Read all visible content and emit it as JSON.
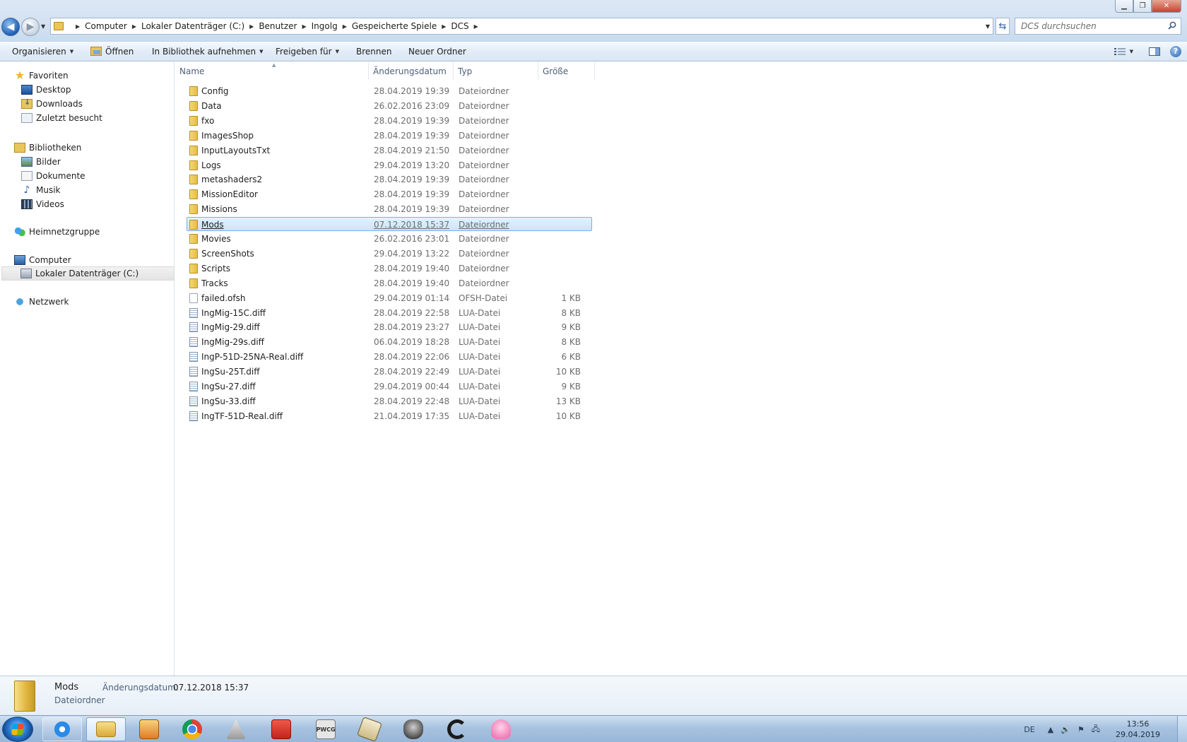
{
  "window": {
    "minimize_glyph": "▁",
    "maximize_glyph": "❐",
    "close_glyph": "✕"
  },
  "nav_buttons": {
    "back_glyph": "◀",
    "forward_glyph": "▶",
    "history_glyph": "▼"
  },
  "address_bar": {
    "breadcrumbs": [
      "Computer",
      "Lokaler Datenträger (C:)",
      "Benutzer",
      "Ingolg",
      "Gespeicherte Spiele",
      "DCS"
    ],
    "separator_glyph": "▶",
    "dropdown_glyph": "▼",
    "refresh_glyph": "⇆"
  },
  "search": {
    "placeholder": "DCS durchsuchen",
    "icon": "search-icon"
  },
  "command_bar": {
    "organize": "Organisieren",
    "open": "Öffnen",
    "include_in_library": "In Bibliothek aufnehmen",
    "share_with": "Freigeben für",
    "burn": "Brennen",
    "new_folder": "Neuer Ordner",
    "arrow_glyph": "▼",
    "help_glyph": "?"
  },
  "nav_pane": {
    "favorites": {
      "label": "Favoriten",
      "items": [
        "Desktop",
        "Downloads",
        "Zuletzt besucht"
      ]
    },
    "libraries": {
      "label": "Bibliotheken",
      "items": [
        "Bilder",
        "Dokumente",
        "Musik",
        "Videos"
      ]
    },
    "homegroup": {
      "label": "Heimnetzgruppe"
    },
    "computer": {
      "label": "Computer",
      "items": [
        "Lokaler Datenträger (C:)"
      ],
      "selected": "Lokaler Datenträger (C:)"
    },
    "network": {
      "label": "Netzwerk"
    },
    "star_glyph": "★",
    "music_glyph": "♪"
  },
  "columns": {
    "name": "Name",
    "date": "Änderungsdatum",
    "type": "Typ",
    "size": "Größe",
    "sort_glyph": "▲"
  },
  "files": [
    {
      "name": "Config",
      "date": "28.04.2019 19:39",
      "type": "Dateiordner",
      "size": "",
      "kind": "folder"
    },
    {
      "name": "Data",
      "date": "26.02.2016 23:09",
      "type": "Dateiordner",
      "size": "",
      "kind": "folder"
    },
    {
      "name": "fxo",
      "date": "28.04.2019 19:39",
      "type": "Dateiordner",
      "size": "",
      "kind": "folder"
    },
    {
      "name": "ImagesShop",
      "date": "28.04.2019 19:39",
      "type": "Dateiordner",
      "size": "",
      "kind": "folder"
    },
    {
      "name": "InputLayoutsTxt",
      "date": "28.04.2019 21:50",
      "type": "Dateiordner",
      "size": "",
      "kind": "folder"
    },
    {
      "name": "Logs",
      "date": "29.04.2019 13:20",
      "type": "Dateiordner",
      "size": "",
      "kind": "folder"
    },
    {
      "name": "metashaders2",
      "date": "28.04.2019 19:39",
      "type": "Dateiordner",
      "size": "",
      "kind": "folder"
    },
    {
      "name": "MissionEditor",
      "date": "28.04.2019 19:39",
      "type": "Dateiordner",
      "size": "",
      "kind": "folder"
    },
    {
      "name": "Missions",
      "date": "28.04.2019 19:39",
      "type": "Dateiordner",
      "size": "",
      "kind": "folder"
    },
    {
      "name": "Mods",
      "date": "07.12.2018 15:37",
      "type": "Dateiordner",
      "size": "",
      "kind": "folder",
      "selected": true
    },
    {
      "name": "Movies",
      "date": "26.02.2016 23:01",
      "type": "Dateiordner",
      "size": "",
      "kind": "folder"
    },
    {
      "name": "ScreenShots",
      "date": "29.04.2019 13:22",
      "type": "Dateiordner",
      "size": "",
      "kind": "folder"
    },
    {
      "name": "Scripts",
      "date": "28.04.2019 19:40",
      "type": "Dateiordner",
      "size": "",
      "kind": "folder"
    },
    {
      "name": "Tracks",
      "date": "28.04.2019 19:40",
      "type": "Dateiordner",
      "size": "",
      "kind": "folder"
    },
    {
      "name": "failed.ofsh",
      "date": "29.04.2019 01:14",
      "type": "OFSH-Datei",
      "size": "1 KB",
      "kind": "file"
    },
    {
      "name": "IngMig-15C.diff",
      "date": "28.04.2019 22:58",
      "type": "LUA-Datei",
      "size": "8 KB",
      "kind": "lua"
    },
    {
      "name": "IngMig-29.diff",
      "date": "28.04.2019 23:27",
      "type": "LUA-Datei",
      "size": "9 KB",
      "kind": "lua"
    },
    {
      "name": "IngMig-29s.diff",
      "date": "06.04.2019 18:28",
      "type": "LUA-Datei",
      "size": "8 KB",
      "kind": "lua"
    },
    {
      "name": "IngP-51D-25NA-Real.diff",
      "date": "28.04.2019 22:06",
      "type": "LUA-Datei",
      "size": "6 KB",
      "kind": "lua"
    },
    {
      "name": "IngSu-25T.diff",
      "date": "28.04.2019 22:49",
      "type": "LUA-Datei",
      "size": "10 KB",
      "kind": "lua"
    },
    {
      "name": "IngSu-27.diff",
      "date": "29.04.2019 00:44",
      "type": "LUA-Datei",
      "size": "9 KB",
      "kind": "lua"
    },
    {
      "name": "IngSu-33.diff",
      "date": "28.04.2019 22:48",
      "type": "LUA-Datei",
      "size": "13 KB",
      "kind": "lua"
    },
    {
      "name": "IngTF-51D-Real.diff",
      "date": "21.04.2019 17:35",
      "type": "LUA-Datei",
      "size": "10 KB",
      "kind": "lua"
    }
  ],
  "details": {
    "name": "Mods",
    "type": "Dateiordner",
    "date_label": "Änderungsdatum:",
    "date_value": "07.12.2018 15:37"
  },
  "taskbar": {
    "pinned": [
      "internet-explorer-icon",
      "windows-explorer-icon",
      "media-player-icon",
      "chrome-icon",
      "dcs-icon",
      "red-app-icon",
      "pwcg-icon",
      "paper-icon",
      "mask-icon",
      "logitech-icon",
      "octopus-icon"
    ],
    "pwcg_label": "PWCG",
    "language": "DE",
    "tray_glyphs": {
      "expand": "▲",
      "volume": "🔊",
      "flag": "⚑",
      "network": "🖧"
    },
    "clock_time": "13:56",
    "clock_date": "29.04.2019"
  },
  "colors": {
    "selection_bg": "#cce3fb",
    "selection_border": "#7daee8",
    "header_text": "#4c607a",
    "muted_text": "#6d6d6d"
  }
}
